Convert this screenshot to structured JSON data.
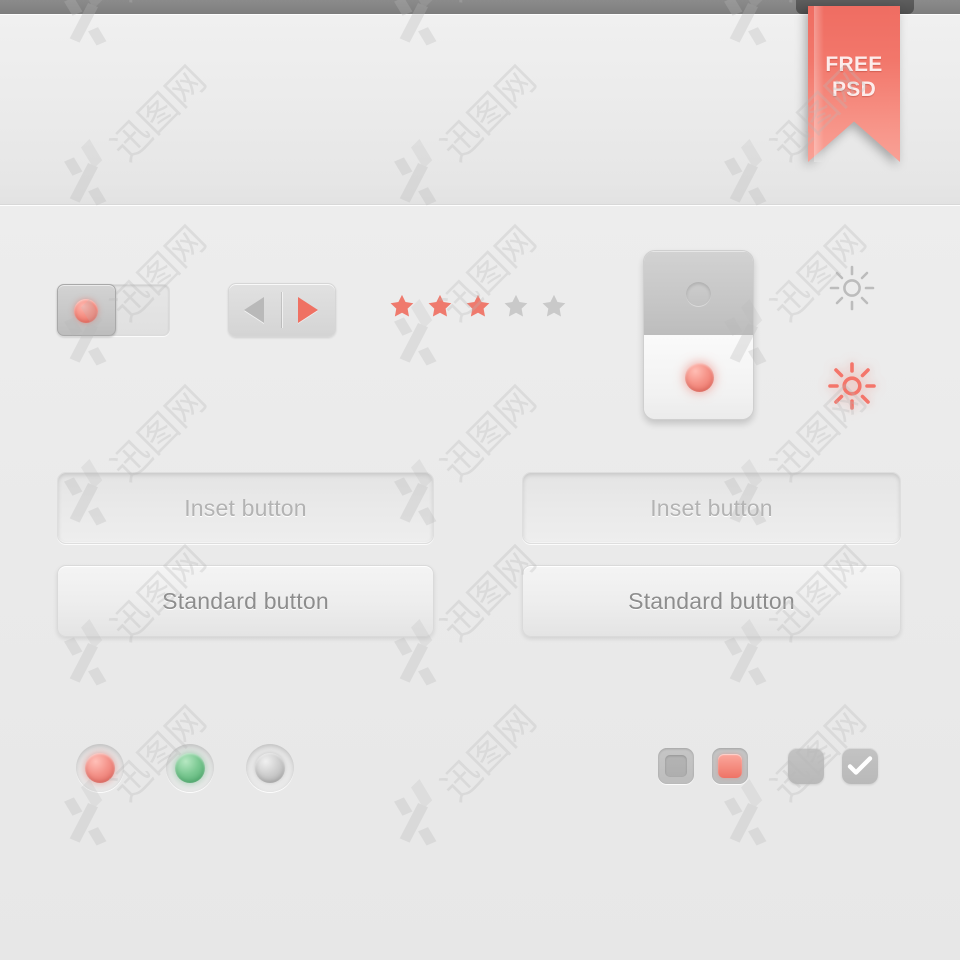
{
  "ribbon": {
    "line1": "FREE",
    "line2": "PSD",
    "color": "#f2776b"
  },
  "theme": {
    "accent": "#ef7163",
    "accent_light": "#f9a196",
    "background": "#eaeaea",
    "topbar": "#848484",
    "text_gray": "#8d8d8d",
    "text_inset": "#b3b3b3",
    "green": "#4aa76a"
  },
  "controls": {
    "toggle": {
      "name": "toggle-switch",
      "state": "off",
      "knob_side": "left",
      "led_color": "#ef7163"
    },
    "segmented": {
      "name": "prev-next-control",
      "buttons": [
        {
          "icon": "triangle-left-icon",
          "label": "Previous",
          "color": "#b9b9b9",
          "active": false
        },
        {
          "icon": "triangle-right-icon",
          "label": "Next",
          "color": "#ef7163",
          "active": true
        }
      ]
    },
    "rating": {
      "name": "star-rating",
      "max": 5,
      "value": 3,
      "filled_color": "#ef7a6d",
      "empty_color": "#c9c9c9"
    },
    "rocker": {
      "name": "vertical-rocker-switch",
      "top_state": "off",
      "bottom_state": "on",
      "on_color": "#ee7366"
    },
    "sun_icons": [
      {
        "name": "brightness-icon-off",
        "color": "#bcbcbc",
        "state": "dim"
      },
      {
        "name": "brightness-icon-on",
        "color": "#f4756a",
        "state": "bright"
      }
    ]
  },
  "buttons": {
    "left_column": [
      {
        "label": "Inset button",
        "style": "inset"
      },
      {
        "label": "Standard button",
        "style": "standard"
      }
    ],
    "right_column": [
      {
        "label": "Inset button",
        "style": "inset"
      },
      {
        "label": "Standard button",
        "style": "standard"
      }
    ]
  },
  "radios": [
    {
      "name": "led-indicator-red",
      "color": "#e2675e",
      "state": "on"
    },
    {
      "name": "led-indicator-green",
      "color": "#4aa76a",
      "state": "on"
    },
    {
      "name": "led-indicator-gray",
      "color": "#a9a9a9",
      "state": "off"
    }
  ],
  "checkboxes": [
    {
      "name": "checkbox-empty-inset",
      "checked": false,
      "style": "inset"
    },
    {
      "name": "checkbox-filled-red",
      "checked": true,
      "style": "inset-filled",
      "color": "#ee7366"
    },
    {
      "name": "checkbox-plain",
      "checked": false,
      "style": "plain"
    },
    {
      "name": "checkbox-checked",
      "checked": true,
      "style": "plain-check"
    }
  ],
  "watermark": {
    "text": "迅图网",
    "opacity": "0.30"
  }
}
